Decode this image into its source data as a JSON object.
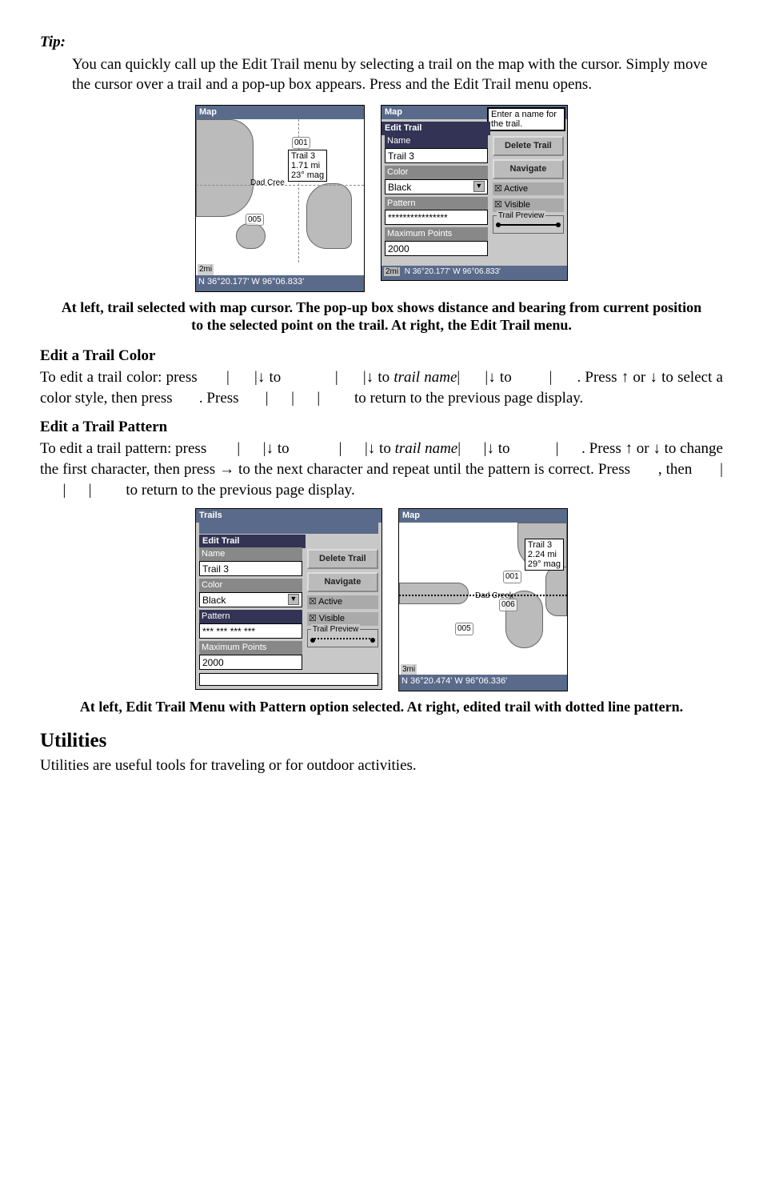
{
  "tip": {
    "label": "Tip:",
    "body": "You can quickly call up the Edit Trail menu by selecting a trail on the map with the cursor. Simply move the cursor over a trail and a pop-up box appears. Press         and the Edit Trail menu opens."
  },
  "fig1": {
    "left": {
      "title": "Map",
      "popup_name": "Trail 3",
      "popup_l2": "1.71 mi",
      "popup_l3": "23° mag",
      "label1": "001",
      "label2": "005",
      "dad": "Dad Cree",
      "scale": "2mi",
      "status": "N  36°20.177'  W  96°06.833'"
    },
    "right": {
      "title": "Map",
      "edit": "Edit Trail",
      "tooltip": "Enter a name for the trail.",
      "name_lbl": "Name",
      "name_val": "Trail 3",
      "color_lbl": "Color",
      "color_val": "Black",
      "pattern_lbl": "Pattern",
      "pattern_val": "****************",
      "max_lbl": "Maximum Points",
      "max_val": "2000",
      "delete": "Delete Trail",
      "nav": "Navigate",
      "active": "Active",
      "visible": "Visible",
      "preview": "Trail Preview",
      "scale": "2mi",
      "status": "N  36°20.177'  W  96°06.833'"
    },
    "caption": "At left, trail selected with map cursor. The pop-up box shows distance and bearing from current position to the selected point on the trail. At right, the Edit Trail menu."
  },
  "edit_color": {
    "heading": "Edit a Trail Color",
    "text": "To edit a trail color: press           |          |↓ to               |       |↓ to trail name|       |↓ to          |       . Press ↑ or ↓ to select a color style, then press        . Press        |       |       |         to return to the previous page display."
  },
  "edit_pattern": {
    "heading": "Edit a Trail Pattern",
    "text": "To edit a trail pattern: press           |          |↓ to               |       |↓ to trail name|       |↓ to            |       . Press ↑ or ↓ to change the first character, then press → to the next character and repeat until the pattern is correct. Press        , then        |       |       |         to return to the previous page display."
  },
  "fig2": {
    "left": {
      "title": "Trails",
      "edit": "Edit Trail",
      "name_lbl": "Name",
      "name_val": "Trail 3",
      "color_lbl": "Color",
      "color_val": "Black",
      "pattern_lbl": "Pattern",
      "pattern_val": "*** *** *** ***",
      "max_lbl": "Maximum Points",
      "max_val": "2000",
      "delete": "Delete Trail",
      "nav": "Navigate",
      "active": "Active",
      "visible": "Visible",
      "preview": "Trail Preview"
    },
    "right": {
      "title": "Map",
      "popup_name": "Trail 3",
      "popup_l2": "2.24 mi",
      "popup_l3": "29° mag",
      "dad": "Dad Creek",
      "l001": "001",
      "l005": "005",
      "l006": "006",
      "scale": "3mi",
      "status": "N  36°20.474'  W  96°06.336'"
    },
    "caption": "At left, Edit Trail Menu with Pattern option selected. At right, edited trail with dotted line pattern."
  },
  "utilities": {
    "heading": "Utilities",
    "text": "Utilities are useful tools for traveling or for outdoor activities."
  }
}
